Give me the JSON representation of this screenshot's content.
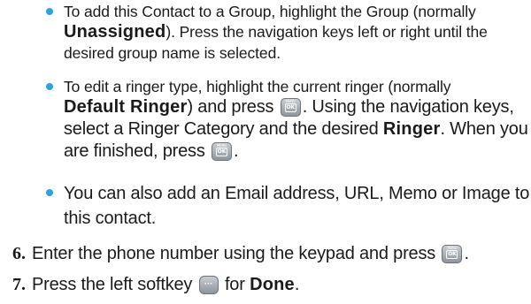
{
  "bullets": [
    {
      "line1": "To add this Contact to a Group, highlight the Group (normally",
      "bold1": "Unassigned",
      "rest1": "). Press the navigation keys left or right until the",
      "line3": "desired group name is selected."
    },
    {
      "line1": "To edit a ringer type, highlight the current ringer (normally",
      "bold1": "Default Ringer",
      "mid1": ") and press ",
      "after_key": ". Using the navigation keys,",
      "line3a": "select a Ringer Category and the desired ",
      "bold2": "Ringer",
      "line3b": ". When you",
      "line4": "are finished, press ",
      "line4_end": "."
    },
    {
      "line1": "You can also add an Email address, URL, Memo or Image to",
      "line2": "this contact."
    }
  ],
  "steps": [
    {
      "number": "6.",
      "text": "Enter the phone number using the keypad and press ",
      "end": "."
    },
    {
      "number": "7.",
      "text_a": "Press the left softkey ",
      "text_b": " for ",
      "bold": "Done",
      "end": "."
    }
  ],
  "keys": {
    "ok_key": {
      "top_label": "MENU",
      "label": "OK",
      "icon": "menu-ok-key-icon"
    },
    "softkey": {
      "label": "···",
      "icon": "left-softkey-icon"
    }
  },
  "colors": {
    "bullet": "#2ba3e0",
    "text": "#1a1a1a"
  }
}
